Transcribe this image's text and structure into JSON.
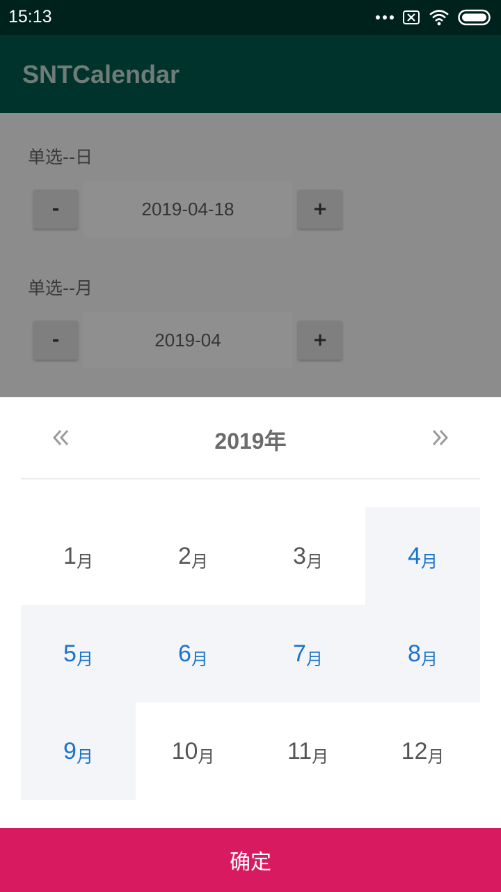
{
  "status_bar": {
    "time": "15:13"
  },
  "app_bar": {
    "title": "SNTCalendar"
  },
  "sections": [
    {
      "label": "单选--日",
      "value": "2019-04-18",
      "minus": "-",
      "plus": "+"
    },
    {
      "label": "单选--月",
      "value": "2019-04",
      "minus": "-",
      "plus": "+"
    }
  ],
  "picker": {
    "year": "2019年",
    "months": [
      {
        "num": "1",
        "unit": "月",
        "in_range": false
      },
      {
        "num": "2",
        "unit": "月",
        "in_range": false
      },
      {
        "num": "3",
        "unit": "月",
        "in_range": false
      },
      {
        "num": "4",
        "unit": "月",
        "in_range": true
      },
      {
        "num": "5",
        "unit": "月",
        "in_range": true
      },
      {
        "num": "6",
        "unit": "月",
        "in_range": true
      },
      {
        "num": "7",
        "unit": "月",
        "in_range": true
      },
      {
        "num": "8",
        "unit": "月",
        "in_range": true
      },
      {
        "num": "9",
        "unit": "月",
        "in_range": true
      },
      {
        "num": "10",
        "unit": "月",
        "in_range": false
      },
      {
        "num": "11",
        "unit": "月",
        "in_range": false
      },
      {
        "num": "12",
        "unit": "月",
        "in_range": false
      }
    ],
    "confirm_label": "确定"
  },
  "colors": {
    "accent": "#d81b60",
    "selected_text": "#1a73c9",
    "range_bg": "#f4f5f9",
    "status_bar": "#00221c",
    "app_bar": "#00332b"
  },
  "icons": [
    "wifi-icon",
    "battery-icon",
    "sim-off-icon",
    "more-dots-icon",
    "double-chevron-left-icon",
    "double-chevron-right-icon"
  ]
}
